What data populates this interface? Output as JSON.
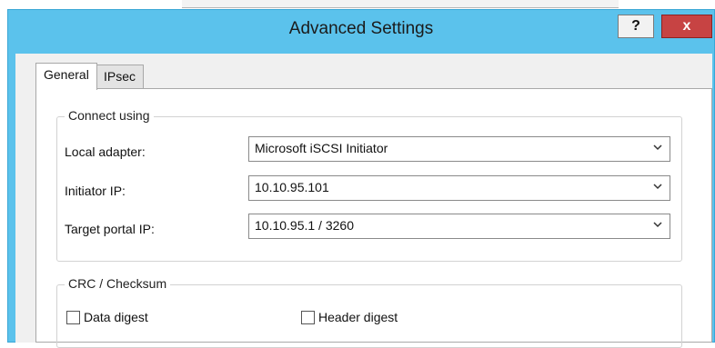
{
  "dialog": {
    "title": "Advanced Settings",
    "help_label": "?",
    "close_label": "x"
  },
  "tabs": [
    {
      "label": "General",
      "selected": true
    },
    {
      "label": "IPsec",
      "selected": false
    }
  ],
  "connect_using": {
    "legend": "Connect using",
    "local_adapter": {
      "label": "Local adapter:",
      "value": "Microsoft iSCSI Initiator"
    },
    "initiator_ip": {
      "label": "Initiator IP:",
      "value": "10.10.95.101"
    },
    "target_portal_ip": {
      "label": "Target portal IP:",
      "value": "10.10.95.1 / 3260"
    }
  },
  "crc": {
    "legend": "CRC / Checksum",
    "data_digest": {
      "label": "Data digest",
      "checked": false
    },
    "header_digest": {
      "label": "Header digest",
      "checked": false
    }
  },
  "colors": {
    "titlebar": "#5bc2ec",
    "close_button": "#c74343"
  }
}
